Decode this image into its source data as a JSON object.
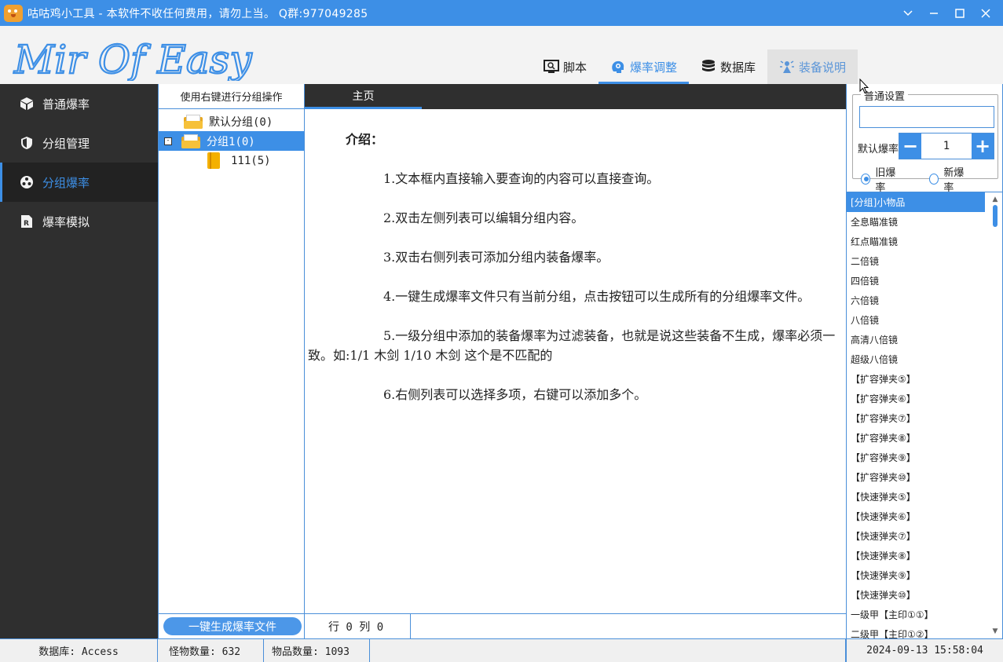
{
  "window": {
    "title": "咕咕鸡小工具 - 本软件不收任何费用，请勿上当。  Q群:977049285"
  },
  "logo": {
    "text": "Mir Of Easy"
  },
  "nav": {
    "items": [
      {
        "label": "脚本",
        "icon": "script-monitor-icon"
      },
      {
        "label": "爆率调整",
        "icon": "brain-gear-icon"
      },
      {
        "label": "数据库",
        "icon": "database-icon"
      },
      {
        "label": "装备说明",
        "icon": "sparkle-figure-icon"
      }
    ],
    "active_index": 1
  },
  "sidebar": {
    "items": [
      {
        "label": "普通爆率",
        "icon": "cube-icon"
      },
      {
        "label": "分组管理",
        "icon": "shield-icon"
      },
      {
        "label": "分组爆率",
        "icon": "group-dots-icon"
      },
      {
        "label": "爆率模拟",
        "icon": "prescription-doc-icon"
      }
    ],
    "active_index": 2
  },
  "group_panel": {
    "header": "使用右键进行分组操作",
    "tree": [
      {
        "label": "默认分组(0)",
        "type": "folder"
      },
      {
        "label": "分组1(0)",
        "type": "folder",
        "expander": "-",
        "selected": true
      },
      {
        "label": "111(5)",
        "type": "book"
      }
    ],
    "generate_button": "一键生成爆率文件"
  },
  "main": {
    "tab": "主页",
    "intro": "介绍：",
    "paragraphs": [
      "1.文本框内直接输入要查询的内容可以直接查询。",
      "2.双击左侧列表可以编辑分组内容。",
      "3.双击右侧列表可添加分组内装备爆率。",
      "4.一键生成爆率文件只有当前分组，点击按钮可以生成所有的分组爆率文件。",
      "5.一级分组中添加的装备爆率为过滤装备，也就是说这些装备不生成，爆率必须一致。如:1/1 木剑      1/10 木剑 这个是不匹配的",
      "6.右侧列表可以选择多项，右键可以添加多个。"
    ],
    "status": "行 0 列 0"
  },
  "settings": {
    "legend": "普通设置",
    "search_value": "",
    "default_rate_label": "默认爆率",
    "default_rate_value": "1",
    "minus": "−",
    "plus": "+",
    "radio_old": "旧爆率",
    "radio_new": "新爆率",
    "radio_selected": "old"
  },
  "item_list": [
    "[分组]小物品",
    "全息瞄准镜",
    "红点瞄准镜",
    "二倍镜",
    "四倍镜",
    "六倍镜",
    "八倍镜",
    "高清八倍镜",
    "超级八倍镜",
    "【扩容弹夹⑤】",
    "【扩容弹夹⑥】",
    "【扩容弹夹⑦】",
    "【扩容弹夹⑧】",
    "【扩容弹夹⑨】",
    "【扩容弹夹⑩】",
    "【快速弹夹⑤】",
    "【快速弹夹⑥】",
    "【快速弹夹⑦】",
    "【快速弹夹⑧】",
    "【快速弹夹⑨】",
    "【快速弹夹⑩】",
    "一级甲【主印①①】",
    "二级甲【主印①②】"
  ],
  "statusbar": {
    "database": "数据库: Access",
    "monsters": "怪物数量: 632",
    "items": "物品数量: 1093",
    "datetime": "2024-09-13 15:58:04"
  },
  "colors": {
    "accent": "#3d8fe6",
    "titlebar": "#3d8fe6",
    "sidebar_bg": "#2f2f2f"
  }
}
